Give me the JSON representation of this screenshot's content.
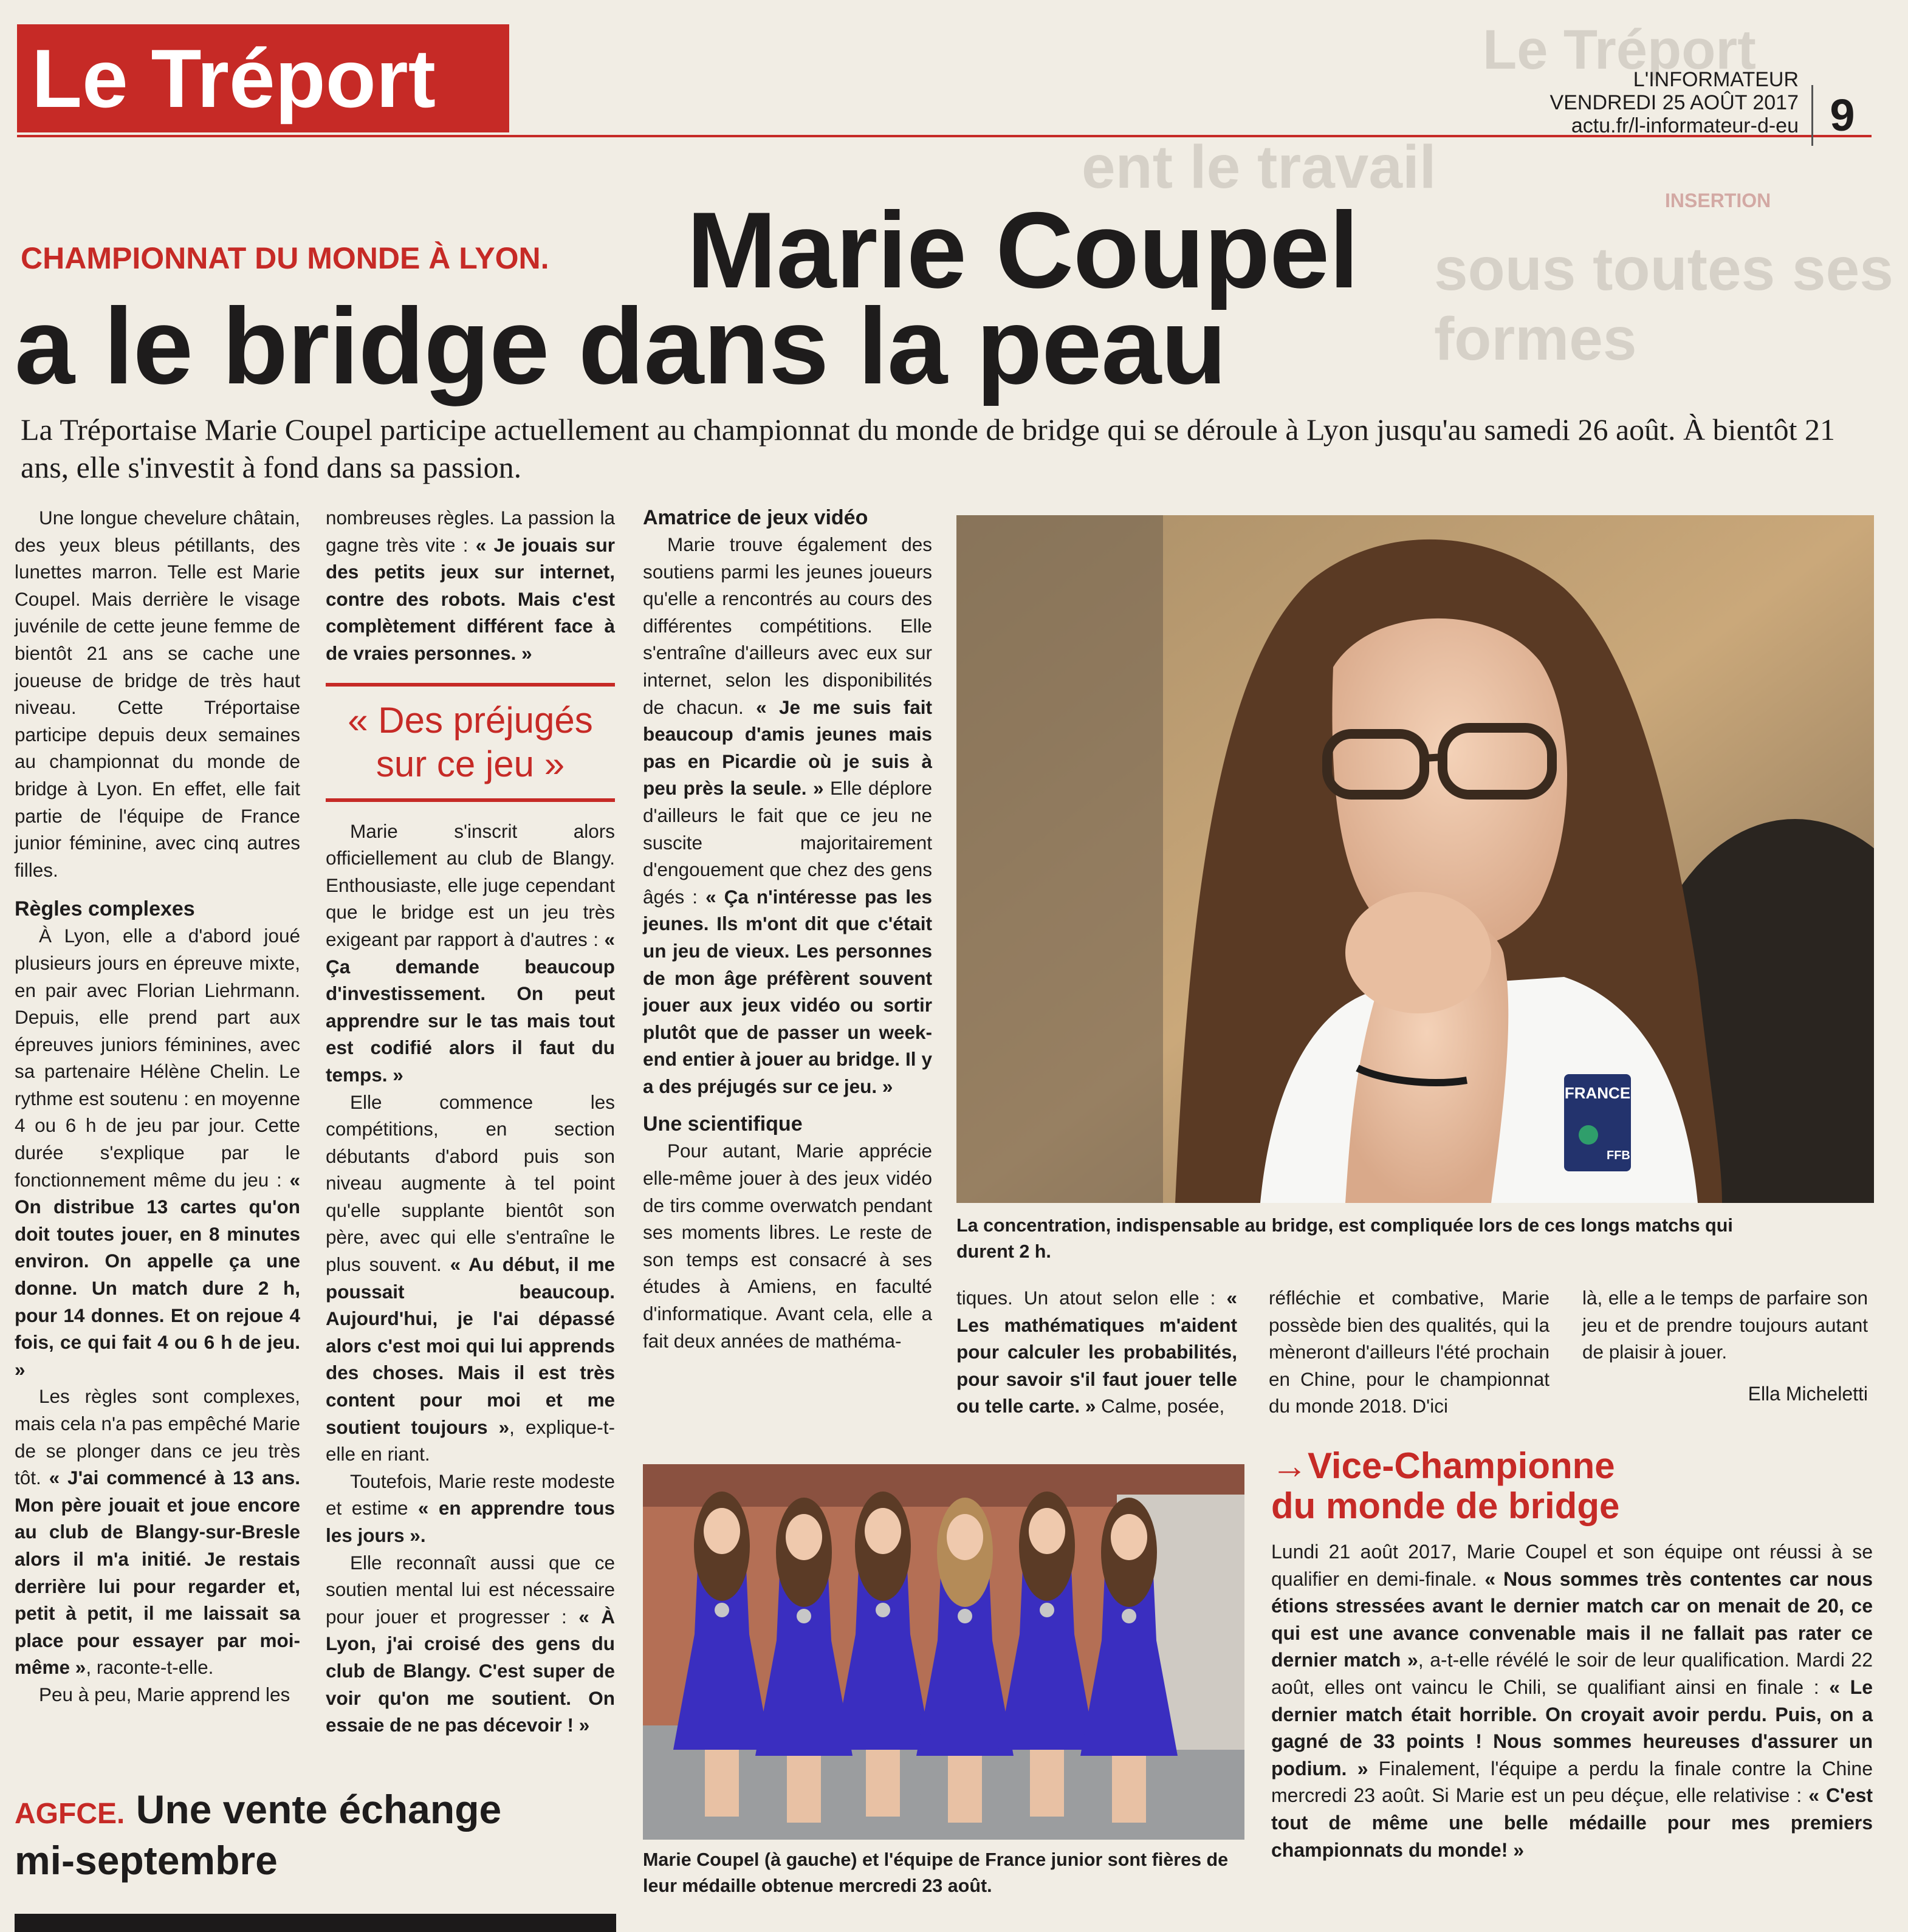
{
  "masthead": {
    "section": "Le Tréport",
    "ghost_section": "Le Tréport",
    "ghost_text_1": "INSERTION",
    "ghost_text_2": "ent le travail",
    "ghost_text_3": "sous toutes ses formes"
  },
  "folio": {
    "paper": "L'INFORMATEUR",
    "date": "VENDREDI 25 AOÛT 2017",
    "url": "actu.fr/l-informateur-d-eu",
    "page": "9"
  },
  "article": {
    "kicker": "CHAMPIONNAT DU MONDE À LYON.",
    "title_line1": "Marie Coupel",
    "title_line2": "a le bridge dans la peau",
    "chapo": "La Tréportaise Marie Coupel participe actuellement au championnat du monde de bridge qui se déroule à Lyon jusqu'au samedi 26 août. À bientôt 21 ans, elle s'investit à fond dans sa passion.",
    "col1_p1": "Une longue chevelure châtain, des yeux bleus pétillants, des lunettes marron. Telle est Marie Coupel. Mais derrière le visage juvénile de cette jeune femme de bientôt 21 ans se cache une joueuse de bridge de très haut niveau. Cette Tréportaise participe depuis deux semaines au championnat du monde de bridge à Lyon. En effet, elle fait partie de l'équipe de France junior féminine, avec cinq autres filles.",
    "sub1": "Règles complexes",
    "col1_p2": "À Lyon, elle a d'abord joué plusieurs jours en épreuve mixte, en pair avec Florian Liehrmann. Depuis, elle prend part aux épreuves juniors féminines, avec sa partenaire Hélène Chelin. Le rythme est soutenu : en moyenne 4 ou 6 h de jeu par jour. Cette durée s'explique par le fonctionnement même du jeu :",
    "col1_q1": "« On distribue 13 cartes qu'on doit toutes jouer, en 8 minutes environ. On appelle ça une donne. Un match dure 2 h, pour 14 donnes. Et on rejoue 4 fois, ce qui fait 4 ou 6 h de jeu. »",
    "col1_p3": "Les règles sont complexes, mais cela n'a pas empêché Marie de se plonger dans ce jeu très tôt.",
    "col1_q2": "« J'ai commencé à 13 ans. Mon père jouait et joue encore au club de Blangy-sur-Bresle alors il m'a initié. Je restais derrière lui pour regarder et, petit à petit, il me laissait sa place pour essayer par moi-même »",
    "col1_p3_end": ", raconte-t-elle.",
    "col1_p4": "Peu à peu, Marie apprend les",
    "col2_p1": "nombreuses règles. La passion la gagne très vite :",
    "col2_q1": "« Je jouais sur des petits jeux sur internet, contre des robots. Mais c'est complètement différent face à de vraies personnes. »",
    "pull_quote": "« Des préjugés sur ce jeu »",
    "col2_p2": "Marie s'inscrit alors officiellement au club de Blangy. Enthousiaste, elle juge cependant que le bridge est un jeu très exigeant par rapport à d'autres :",
    "col2_q2": "« Ça demande beaucoup d'investissement. On peut apprendre sur le tas mais tout est codifié alors il faut du temps. »",
    "col2_p3": "Elle commence les compétitions, en section débutants d'abord puis son niveau augmente à tel point qu'elle supplante bientôt son père, avec qui elle s'entraîne le plus souvent.",
    "col2_q3": "« Au début, il me poussait beaucoup. Aujourd'hui, je l'ai dépassé alors c'est moi qui lui apprends des choses. Mais il est très content pour moi et me soutient toujours »",
    "col2_p3_end": ", explique-t-elle en riant.",
    "col2_p4": "Toutefois, Marie reste modeste et estime",
    "col2_q4": "« en apprendre tous les jours ».",
    "col2_p5": "Elle reconnaît aussi que ce soutien mental lui est nécessaire pour jouer et progresser :",
    "col2_q5": "« À Lyon, j'ai croisé des gens du club de Blangy. C'est super de voir qu'on me soutient. On essaie de ne pas décevoir ! »",
    "sub2": "Amatrice de jeux vidéo",
    "col3_p1": "Marie trouve également des soutiens parmi les jeunes joueurs qu'elle a rencontrés au cours des différentes compétitions. Elle s'entraîne d'ailleurs avec eux sur internet, selon les disponibilités de chacun.",
    "col3_q1": "« Je me suis fait beaucoup d'amis jeunes mais pas en Picardie où je suis à peu près la seule. »",
    "col3_p2": "Elle déplore d'ailleurs le fait que ce jeu ne suscite majoritairement d'engouement que chez des gens âgés :",
    "col3_q2": "« Ça n'intéresse pas les jeunes. Ils m'ont dit que c'était un jeu de vieux. Les personnes de mon âge préfèrent souvent jouer aux jeux vidéo ou sortir plutôt que de passer un week-end entier à jouer au bridge. Il y a des préjugés sur ce jeu. »",
    "sub3": "Une scientifique",
    "col3_p3": "Pour autant, Marie apprécie elle-même jouer à des jeux vidéo de tirs comme overwatch pendant ses moments libres. Le reste de son temps est consacré à ses études à Amiens, en faculté d'informatique. Avant cela, elle a fait deux années de mathéma-",
    "col4_p1": "tiques. Un atout selon elle :",
    "col4_q1": "« Les mathématiques m'aident pour calculer les probabilités, pour savoir s'il faut jouer telle ou telle carte. »",
    "col4_p1_end": " Calme, posée,",
    "col5_p1": "réfléchie et combative, Marie possède bien des qualités, qui la mèneront d'ailleurs l'été prochain en Chine, pour le championnat du monde 2018. D'ici",
    "col6_p1": "là, elle a le temps de parfaire son jeu et de prendre toujours autant de plaisir à jouer.",
    "byline": "Ella Micheletti",
    "photo1_caption": "La concentration, indispensable au bridge, est compliquée lors de ces longs matchs qui durent 2 h.",
    "photo2_caption": "Marie Coupel (à gauche) et l'équipe de France junior sont fières de leur médaille obtenue mercredi 23 août.",
    "shirt_badge": "FRANCE",
    "shirt_logo": "FFB"
  },
  "box": {
    "arrow": "→",
    "title_line1": "Vice-Championne",
    "title_line2": "du monde de bridge",
    "p1": "Lundi 21 août 2017, Marie Coupel et son équipe ont réussi à se qualifier en demi-finale.",
    "q1": "« Nous sommes très contentes car nous étions stressées avant le dernier match car on menait de 20, ce qui est une avance convenable mais il ne fallait pas rater ce dernier match »",
    "p2": ", a-t-elle révélé le soir de leur qualification. Mardi 22 août, elles ont vaincu le Chili, se qualifiant ainsi en finale :",
    "q2": "« Le dernier match était horrible. On croyait avoir perdu. Puis, on a gagné de 33 points ! Nous sommes heureuses d'assurer un podium. »",
    "p3": "Finalement, l'équipe a perdu la finale contre la Chine mercredi 23 août. Si Marie est un peu déçue, elle relativise :",
    "q3": "« C'est tout de même une belle médaille pour mes premiers championnats du monde! »"
  },
  "teaser": {
    "kicker": "AGFCE.",
    "title_line1": "Une vente échange",
    "title_line2": "mi-septembre"
  },
  "colors": {
    "accent": "#c62a26",
    "paper": "#f1ede4",
    "ink": "#1e1c1c",
    "dress": "#3a2ec0"
  }
}
